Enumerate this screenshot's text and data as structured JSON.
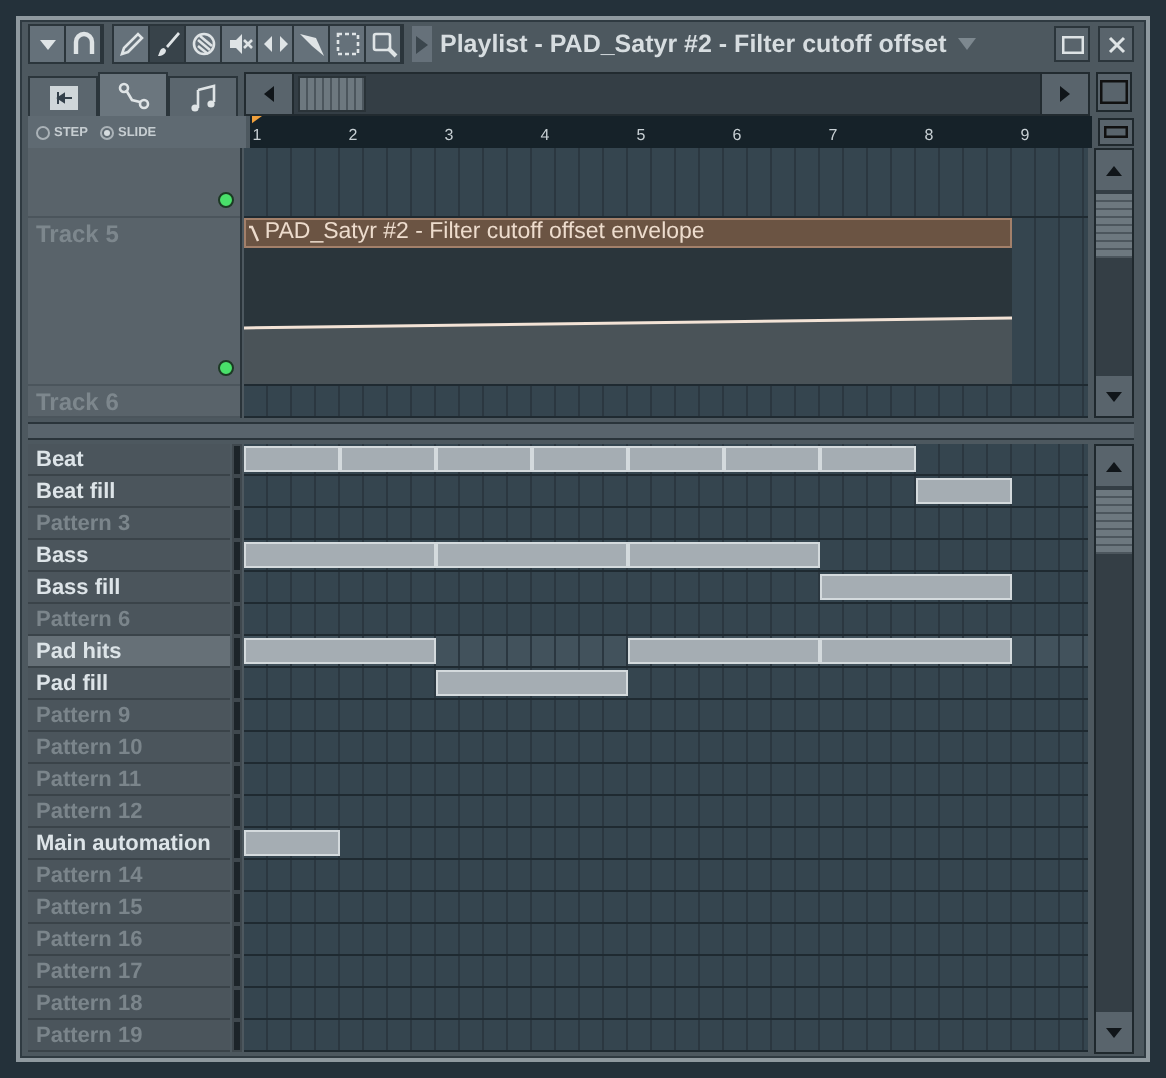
{
  "window": {
    "title": "Playlist - PAD_Satyr #2 - Filter cutoff offset"
  },
  "tools": [
    {
      "kind": "menu",
      "selected": false
    },
    {
      "kind": "magnet",
      "selected": false
    },
    {
      "kind": "pencil",
      "selected": false
    },
    {
      "kind": "brush",
      "selected": true
    },
    {
      "kind": "mute",
      "selected": false
    },
    {
      "kind": "speaker",
      "selected": false
    },
    {
      "kind": "slip",
      "selected": false
    },
    {
      "kind": "slice",
      "selected": false
    },
    {
      "kind": "select",
      "selected": false
    },
    {
      "kind": "zoom",
      "selected": false
    }
  ],
  "view_tabs": [
    {
      "kind": "patterns",
      "selected": false
    },
    {
      "kind": "automation",
      "selected": true
    },
    {
      "kind": "audio",
      "selected": false
    }
  ],
  "snap_mode": [
    {
      "label": "STEP",
      "selected": false
    },
    {
      "label": "SLIDE",
      "selected": true
    }
  ],
  "ruler": [
    "1",
    "2",
    "3",
    "4",
    "5",
    "6",
    "7",
    "8",
    "9"
  ],
  "tracks": [
    {
      "enabled": true
    },
    {
      "name": "Track 5",
      "enabled": true,
      "clip": {
        "title": "PAD_Satyr #2 - Filter cutoff offset envelope",
        "slots": [
          {
            "kind": "start"
          },
          {
            "kind": "continue"
          },
          {
            "kind": "continue"
          },
          {
            "kind": "continue"
          },
          {
            "kind": "continue"
          },
          {
            "kind": "continue"
          },
          {
            "kind": "continue"
          },
          {
            "kind": "continue"
          }
        ]
      }
    },
    {
      "name": "Track 6"
    }
  ],
  "patterns": [
    {
      "name": "Beat",
      "used": true,
      "selected": false,
      "slots": [
        {
          "kind": "start"
        },
        {
          "kind": "start"
        },
        {
          "kind": "start"
        },
        {
          "kind": "start"
        },
        {
          "kind": "start"
        },
        {
          "kind": "start"
        },
        {
          "kind": "start"
        }
      ]
    },
    {
      "name": "Beat fill",
      "used": true,
      "selected": false,
      "slots": [
        {
          "kind": "empty"
        },
        {
          "kind": "empty"
        },
        {
          "kind": "empty"
        },
        {
          "kind": "empty"
        },
        {
          "kind": "empty"
        },
        {
          "kind": "empty"
        },
        {
          "kind": "empty"
        },
        {
          "kind": "start"
        }
      ]
    },
    {
      "name": "Pattern 3",
      "used": false,
      "selected": false
    },
    {
      "name": "Bass",
      "used": true,
      "selected": false,
      "slots": [
        {
          "kind": "start"
        },
        {
          "kind": "continue"
        },
        {
          "kind": "start"
        },
        {
          "kind": "continue"
        },
        {
          "kind": "start"
        },
        {
          "kind": "continue"
        }
      ]
    },
    {
      "name": "Bass fill",
      "used": true,
      "selected": false,
      "slots": [
        {
          "kind": "empty"
        },
        {
          "kind": "empty"
        },
        {
          "kind": "empty"
        },
        {
          "kind": "empty"
        },
        {
          "kind": "empty"
        },
        {
          "kind": "empty"
        },
        {
          "kind": "start"
        },
        {
          "kind": "continue"
        }
      ]
    },
    {
      "name": "Pattern 6",
      "used": false,
      "selected": false
    },
    {
      "name": "Pad hits",
      "used": true,
      "selected": true,
      "slots": [
        {
          "kind": "start"
        },
        {
          "kind": "continue"
        },
        {
          "kind": "empty"
        },
        {
          "kind": "empty"
        },
        {
          "kind": "start"
        },
        {
          "kind": "continue"
        },
        {
          "kind": "start"
        },
        {
          "kind": "continue"
        }
      ]
    },
    {
      "name": "Pad fill",
      "used": true,
      "selected": false,
      "slots": [
        {
          "kind": "empty"
        },
        {
          "kind": "empty"
        },
        {
          "kind": "start"
        },
        {
          "kind": "continue"
        }
      ]
    },
    {
      "name": "Pattern 9",
      "used": false,
      "selected": false
    },
    {
      "name": "Pattern 10",
      "used": false,
      "selected": false
    },
    {
      "name": "Pattern 11",
      "used": false,
      "selected": false
    },
    {
      "name": "Pattern 12",
      "used": false,
      "selected": false
    },
    {
      "name": "Main automation",
      "used": true,
      "selected": false,
      "slots": [
        {
          "kind": "start"
        }
      ]
    },
    {
      "name": "Pattern 14",
      "used": false,
      "selected": false
    },
    {
      "name": "Pattern 15",
      "used": false,
      "selected": false
    },
    {
      "name": "Pattern 16",
      "used": false,
      "selected": false
    },
    {
      "name": "Pattern 17",
      "used": false,
      "selected": false
    },
    {
      "name": "Pattern 18",
      "used": false,
      "selected": false
    },
    {
      "name": "Pattern 19",
      "used": false,
      "selected": false
    }
  ]
}
